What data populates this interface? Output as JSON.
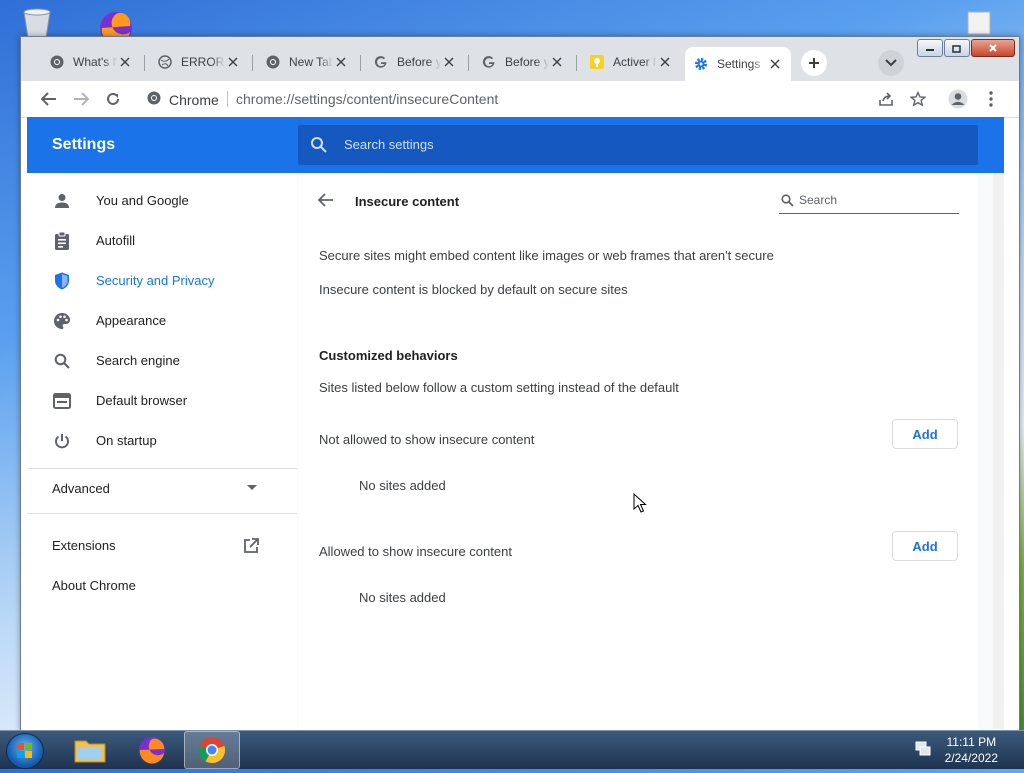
{
  "browser": {
    "tabs": [
      {
        "title": "What's N",
        "icon": "chrome-icon"
      },
      {
        "title": "ERROR: T",
        "icon": "globe-icon"
      },
      {
        "title": "New Tab",
        "icon": "chrome-icon"
      },
      {
        "title": "Before yo",
        "icon": "google-icon"
      },
      {
        "title": "Before yo",
        "icon": "google-icon"
      },
      {
        "title": "Activer l",
        "icon": "bulb-icon"
      },
      {
        "title": "Settings",
        "icon": "gear-icon",
        "active": true
      }
    ],
    "omnibox": {
      "site_label": "Chrome",
      "url": "chrome://settings/content/insecureContent"
    }
  },
  "settings": {
    "header_title": "Settings",
    "search_placeholder": "Search settings",
    "nav": [
      {
        "label": "You and Google",
        "icon": "person-icon"
      },
      {
        "label": "Autofill",
        "icon": "clipboard-icon"
      },
      {
        "label": "Security and Privacy",
        "icon": "shield-icon",
        "selected": true
      },
      {
        "label": "Appearance",
        "icon": "palette-icon"
      },
      {
        "label": "Search engine",
        "icon": "search-icon"
      },
      {
        "label": "Default browser",
        "icon": "browser-window-icon"
      },
      {
        "label": "On startup",
        "icon": "power-icon"
      }
    ],
    "advanced_label": "Advanced",
    "extensions_label": "Extensions",
    "about_label": "About Chrome",
    "page_title": "Insecure content",
    "page_search_placeholder": "Search",
    "description_1": "Secure sites might embed content like images or web frames that aren't secure",
    "description_2": "Insecure content is blocked by default on secure sites",
    "custom_heading": "Customized behaviors",
    "custom_sub": "Sites listed below follow a custom setting instead of the default",
    "not_allowed_label": "Not allowed to show insecure content",
    "allowed_label": "Allowed to show insecure content",
    "add_label": "Add",
    "no_sites": "No sites added",
    "accent_color": "#1a73e8"
  },
  "taskbar": {
    "time": "11:11 PM",
    "date": "2/24/2022"
  }
}
